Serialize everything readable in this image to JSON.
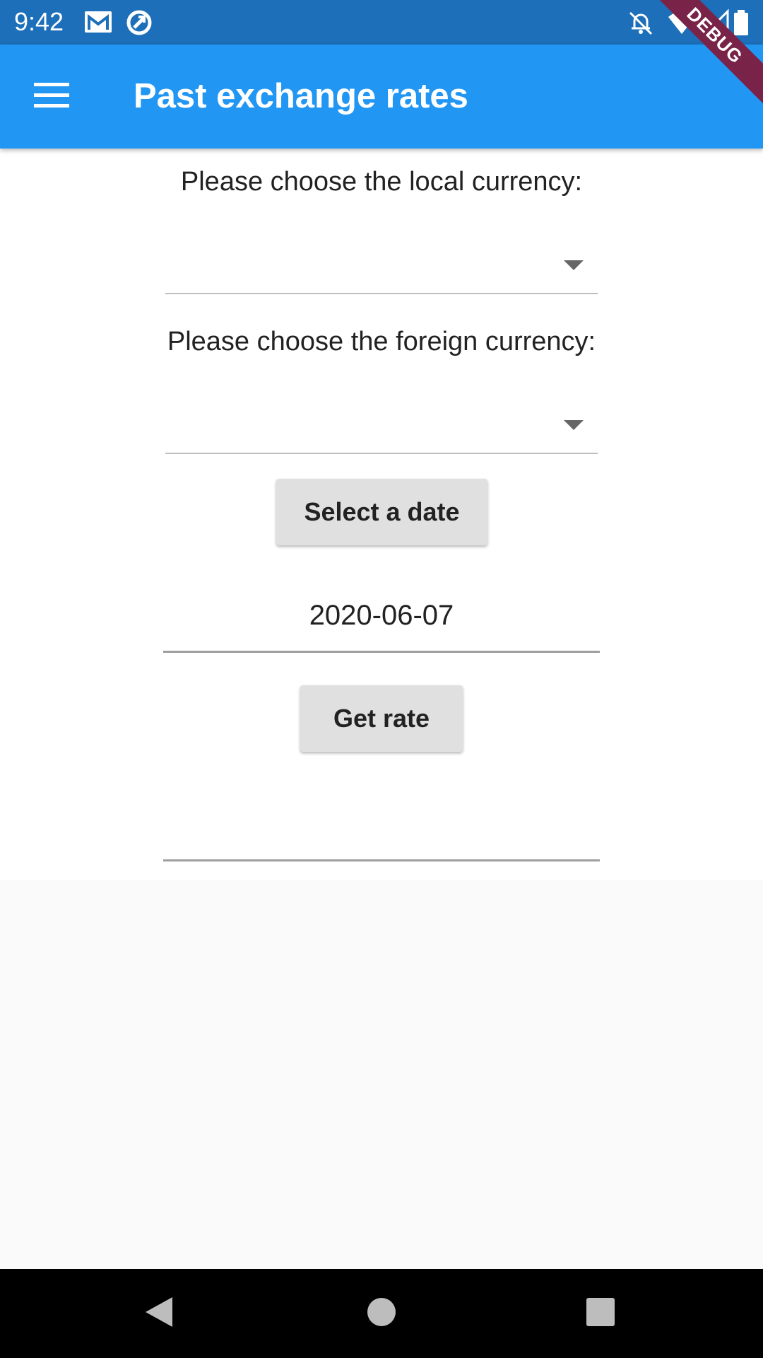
{
  "status_bar": {
    "time": "9:42",
    "icons": [
      "gmail-icon",
      "sync-icon",
      "notifications-off-icon",
      "wifi-icon",
      "signal-icon",
      "battery-icon"
    ]
  },
  "app_bar": {
    "title": "Past exchange rates",
    "menu_icon": "menu-icon",
    "color": "#2196f3"
  },
  "debug_banner": {
    "label": "DEBUG"
  },
  "form": {
    "local_currency_label": "Please choose the local currency:",
    "local_currency_value": "",
    "foreign_currency_label": "Please choose the foreign currency:",
    "foreign_currency_value": "",
    "select_date_button": "Select a date",
    "date_value": "2020-06-07",
    "get_rate_button": "Get rate",
    "result_value": ""
  },
  "nav_bar": {
    "icons": [
      "back-icon",
      "home-icon",
      "recents-icon"
    ]
  }
}
